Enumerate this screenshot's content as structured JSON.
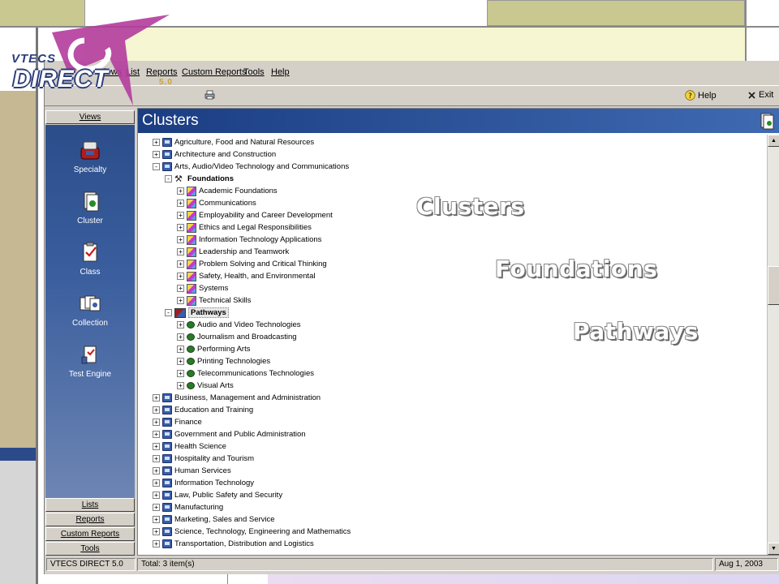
{
  "logo": {
    "brand_top": "VTECS",
    "brand_main": "DIRECT",
    "version": "5.0"
  },
  "menu": [
    {
      "label": "Views"
    },
    {
      "label": "List"
    },
    {
      "label": "Reports"
    },
    {
      "label": "Custom Reports"
    },
    {
      "label": "Tools"
    },
    {
      "label": "Help"
    }
  ],
  "toolbar": {
    "help_label": "Help",
    "exit_label": "Exit"
  },
  "sidebar": {
    "views_label": "Views",
    "items": [
      {
        "label": "Specialty",
        "icon": "specialty-icon"
      },
      {
        "label": "Cluster",
        "icon": "cluster-icon"
      },
      {
        "label": "Class",
        "icon": "class-icon"
      },
      {
        "label": "Collection",
        "icon": "collection-icon"
      },
      {
        "label": "Test Engine",
        "icon": "test-engine-icon"
      }
    ],
    "bottom_buttons": [
      {
        "label": "Lists"
      },
      {
        "label": "Reports"
      },
      {
        "label": "Custom Reports"
      },
      {
        "label": "Tools"
      }
    ]
  },
  "main": {
    "title": "Clusters",
    "tree": [
      {
        "label": "Agriculture, Food and Natural Resources",
        "level": 0,
        "kind": "cluster",
        "expander": "+"
      },
      {
        "label": "Architecture and Construction",
        "level": 0,
        "kind": "cluster",
        "expander": "+"
      },
      {
        "label": "Arts, Audio/Video Technology and Communications",
        "level": 0,
        "kind": "cluster",
        "expander": "-"
      },
      {
        "label": "Foundations",
        "level": 1,
        "kind": "hammer",
        "expander": "-",
        "bold": true
      },
      {
        "label": "Academic Foundations",
        "level": 2,
        "kind": "foundation",
        "expander": "+"
      },
      {
        "label": "Communications",
        "level": 2,
        "kind": "foundation",
        "expander": "+"
      },
      {
        "label": "Employability and Career Development",
        "level": 2,
        "kind": "foundation",
        "expander": "+"
      },
      {
        "label": "Ethics and Legal Responsibilities",
        "level": 2,
        "kind": "foundation",
        "expander": "+"
      },
      {
        "label": "Information Technology Applications",
        "level": 2,
        "kind": "foundation",
        "expander": "+"
      },
      {
        "label": "Leadership and Teamwork",
        "level": 2,
        "kind": "foundation",
        "expander": "+"
      },
      {
        "label": "Problem Solving and Critical Thinking",
        "level": 2,
        "kind": "foundation",
        "expander": "+"
      },
      {
        "label": "Safety, Health, and Environmental",
        "level": 2,
        "kind": "foundation",
        "expander": "+"
      },
      {
        "label": "Systems",
        "level": 2,
        "kind": "foundation",
        "expander": "+"
      },
      {
        "label": "Technical Skills",
        "level": 2,
        "kind": "foundation",
        "expander": "+"
      },
      {
        "label": "Pathways",
        "level": 1,
        "kind": "pathways",
        "expander": "-",
        "bold": true,
        "selected": true
      },
      {
        "label": "Audio and Video Technologies",
        "level": 2,
        "kind": "path",
        "expander": "+"
      },
      {
        "label": "Journalism and Broadcasting",
        "level": 2,
        "kind": "path",
        "expander": "+"
      },
      {
        "label": "Performing Arts",
        "level": 2,
        "kind": "path",
        "expander": "+"
      },
      {
        "label": "Printing Technologies",
        "level": 2,
        "kind": "path",
        "expander": "+"
      },
      {
        "label": "Telecommunications Technologies",
        "level": 2,
        "kind": "path",
        "expander": "+"
      },
      {
        "label": "Visual Arts",
        "level": 2,
        "kind": "path",
        "expander": "+"
      },
      {
        "label": "Business, Management and Administration",
        "level": 0,
        "kind": "cluster",
        "expander": "+"
      },
      {
        "label": "Education and Training",
        "level": 0,
        "kind": "cluster",
        "expander": "+"
      },
      {
        "label": "Finance",
        "level": 0,
        "kind": "cluster",
        "expander": "+"
      },
      {
        "label": "Government and Public Administration",
        "level": 0,
        "kind": "cluster",
        "expander": "+"
      },
      {
        "label": "Health Science",
        "level": 0,
        "kind": "cluster",
        "expander": "+"
      },
      {
        "label": "Hospitality and Tourism",
        "level": 0,
        "kind": "cluster",
        "expander": "+"
      },
      {
        "label": "Human Services",
        "level": 0,
        "kind": "cluster",
        "expander": "+"
      },
      {
        "label": "Information Technology",
        "level": 0,
        "kind": "cluster",
        "expander": "+"
      },
      {
        "label": "Law, Public Safety and Security",
        "level": 0,
        "kind": "cluster",
        "expander": "+"
      },
      {
        "label": "Manufacturing",
        "level": 0,
        "kind": "cluster",
        "expander": "+"
      },
      {
        "label": "Marketing, Sales and Service",
        "level": 0,
        "kind": "cluster",
        "expander": "+"
      },
      {
        "label": "Science, Technology, Engineering and Mathematics",
        "level": 0,
        "kind": "cluster",
        "expander": "+"
      },
      {
        "label": "Transportation, Distribution and Logistics",
        "level": 0,
        "kind": "cluster",
        "expander": "+"
      }
    ]
  },
  "status": {
    "app_name": "VTECS DIRECT 5.0",
    "total": "Total: 3 item(s)",
    "date": "Aug 1, 2003"
  },
  "overlay": {
    "line1": "Clusters",
    "line2": "Foundations",
    "line3": "Pathways"
  },
  "colors": {
    "header_blue": "#1b3d82",
    "sidebar_blue": "#2c4d8a",
    "slide_olive": "#c8c890",
    "slide_cream": "#f6f6d2",
    "logo_magenta": "#b43c9c"
  }
}
